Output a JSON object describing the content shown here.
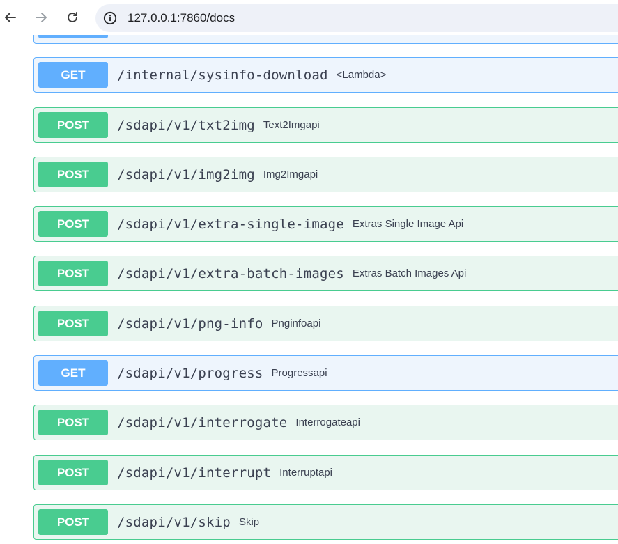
{
  "browser": {
    "url": "127.0.0.1:7860/docs"
  },
  "operations": [
    {
      "method": "GET",
      "path": "/internal/sysinfo-download",
      "summary": "<Lambda>"
    },
    {
      "method": "POST",
      "path": "/sdapi/v1/txt2img",
      "summary": "Text2Imgapi"
    },
    {
      "method": "POST",
      "path": "/sdapi/v1/img2img",
      "summary": "Img2Imgapi"
    },
    {
      "method": "POST",
      "path": "/sdapi/v1/extra-single-image",
      "summary": "Extras Single Image Api"
    },
    {
      "method": "POST",
      "path": "/sdapi/v1/extra-batch-images",
      "summary": "Extras Batch Images Api"
    },
    {
      "method": "POST",
      "path": "/sdapi/v1/png-info",
      "summary": "Pnginfoapi"
    },
    {
      "method": "GET",
      "path": "/sdapi/v1/progress",
      "summary": "Progressapi"
    },
    {
      "method": "POST",
      "path": "/sdapi/v1/interrogate",
      "summary": "Interrogateapi"
    },
    {
      "method": "POST",
      "path": "/sdapi/v1/interrupt",
      "summary": "Interruptapi"
    },
    {
      "method": "POST",
      "path": "/sdapi/v1/skip",
      "summary": "Skip"
    }
  ],
  "colors": {
    "get": "#61affe",
    "post": "#49cc90"
  }
}
